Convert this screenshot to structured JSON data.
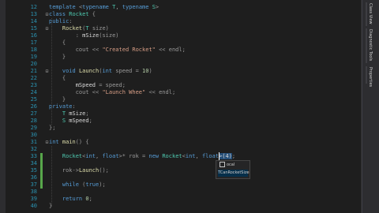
{
  "editor": {
    "lines": [
      {
        "n": "12",
        "tokens": [
          [
            "kw",
            "template "
          ],
          [
            "pa",
            "<"
          ],
          [
            "kw",
            "typename "
          ],
          [
            "ty",
            "T"
          ],
          [
            "pa",
            ", "
          ],
          [
            "kw",
            "typename "
          ],
          [
            "ty",
            "S"
          ],
          [
            "pa",
            ">"
          ]
        ]
      },
      {
        "n": "13",
        "fold": "⊟",
        "tokens": [
          [
            "kw",
            "class "
          ],
          [
            "ty",
            "Rocket"
          ],
          [
            "pa",
            " {"
          ]
        ]
      },
      {
        "n": "14",
        "tokens": [
          [
            "kw",
            "public"
          ],
          [
            "pa",
            ":"
          ]
        ]
      },
      {
        "n": "15",
        "fold": "⊟",
        "tokens": [
          [
            "fn",
            "    Rocket"
          ],
          [
            "pa",
            "("
          ],
          [
            "ty",
            "T "
          ],
          [
            "pa",
            "size)"
          ]
        ]
      },
      {
        "n": "16",
        "tokens": [
          [
            "pa",
            "        : "
          ],
          [
            "mem",
            "mSize"
          ],
          [
            "pa",
            "(size)"
          ]
        ]
      },
      {
        "n": "17",
        "tokens": [
          [
            "pa",
            "    {"
          ]
        ]
      },
      {
        "n": "18",
        "tokens": [
          [
            "pa",
            "        cout << "
          ],
          [
            "st",
            "\"Created Rocket\""
          ],
          [
            "pa",
            " << endl;"
          ]
        ]
      },
      {
        "n": "19",
        "tokens": [
          [
            "pa",
            "    }"
          ]
        ]
      },
      {
        "n": "20",
        "tokens": []
      },
      {
        "n": "21",
        "fold": "⊟",
        "tokens": [
          [
            "kw",
            "    void "
          ],
          [
            "fn",
            "Launch"
          ],
          [
            "pa",
            "("
          ],
          [
            "kw",
            "int "
          ],
          [
            "pa",
            "speed = "
          ],
          [
            "nu",
            "10"
          ],
          [
            "pa",
            ")"
          ]
        ]
      },
      {
        "n": "22",
        "tokens": [
          [
            "pa",
            "    {"
          ]
        ]
      },
      {
        "n": "23",
        "tokens": [
          [
            "mem",
            "        mSpeed"
          ],
          [
            "pa",
            " = speed;"
          ]
        ]
      },
      {
        "n": "24",
        "tokens": [
          [
            "pa",
            "        cout << "
          ],
          [
            "st",
            "\"Launch Whee\""
          ],
          [
            "pa",
            " << endl;"
          ]
        ]
      },
      {
        "n": "25",
        "tokens": [
          [
            "pa",
            "    }"
          ]
        ]
      },
      {
        "n": "26",
        "tokens": [
          [
            "kw",
            "private"
          ],
          [
            "pa",
            ":"
          ]
        ]
      },
      {
        "n": "27",
        "tokens": [
          [
            "ty",
            "    T "
          ],
          [
            "mem",
            "mSize"
          ],
          [
            "pa",
            ";"
          ]
        ]
      },
      {
        "n": "28",
        "tokens": [
          [
            "ty",
            "    S "
          ],
          [
            "mem",
            "mSpeed"
          ],
          [
            "pa",
            ";"
          ]
        ]
      },
      {
        "n": "29",
        "tokens": [
          [
            "pa",
            "};"
          ]
        ]
      },
      {
        "n": "30",
        "tokens": []
      },
      {
        "n": "31",
        "fold": "⊟",
        "tokens": [
          [
            "kw",
            "int "
          ],
          [
            "fn",
            "main"
          ],
          [
            "pa",
            "() {"
          ]
        ]
      },
      {
        "n": "32",
        "tokens": []
      },
      {
        "n": "33",
        "change": true,
        "tokens": [
          [
            "ty",
            "    Rocket"
          ],
          [
            "pa",
            "<"
          ],
          [
            "kw",
            "int"
          ],
          [
            "pa",
            ", "
          ],
          [
            "kw",
            "float"
          ],
          [
            "pa",
            ">* rok = "
          ],
          [
            "kw",
            "new "
          ],
          [
            "ty",
            "Rocket"
          ],
          [
            "pa",
            "<"
          ],
          [
            "kw",
            "int"
          ],
          [
            "pa",
            ", "
          ],
          [
            "kw",
            "float"
          ],
          [
            "hi",
            ">(4)"
          ],
          [
            "pa",
            ";"
          ]
        ]
      },
      {
        "n": "34",
        "change": true,
        "tokens": []
      },
      {
        "n": "35",
        "change": true,
        "tokens": [
          [
            "pa",
            "    rok->"
          ],
          [
            "fn",
            "Launch"
          ],
          [
            "pa",
            "();"
          ]
        ]
      },
      {
        "n": "36",
        "change": true,
        "tokens": []
      },
      {
        "n": "37",
        "change": true,
        "tokens": [
          [
            "kw",
            "    while "
          ],
          [
            "pa",
            "("
          ],
          [
            "kw",
            "true"
          ],
          [
            "pa",
            ");"
          ]
        ]
      },
      {
        "n": "38",
        "tokens": []
      },
      {
        "n": "39",
        "tokens": [
          [
            "kw",
            "    return "
          ],
          [
            "nu",
            "0"
          ],
          [
            "pa",
            ";"
          ]
        ]
      },
      {
        "n": "40",
        "tokens": [
          [
            "pa",
            "}"
          ]
        ]
      }
    ]
  },
  "popup": {
    "items": [
      {
        "label": "ocal",
        "icon": "snippet-icon",
        "selected": false
      },
      {
        "label": "TCanRocketSize",
        "icon": "",
        "selected": true
      }
    ]
  },
  "right_panel": {
    "tabs": [
      "Class View",
      "Diagnostic Tools",
      "Properties"
    ]
  },
  "colors": {
    "background": "#1e1e1e",
    "keyword": "#569cd6",
    "type": "#4ec9b0",
    "function": "#dcdcaa",
    "string": "#d69d85",
    "number": "#b5cea8",
    "line_number": "#2b91af"
  }
}
